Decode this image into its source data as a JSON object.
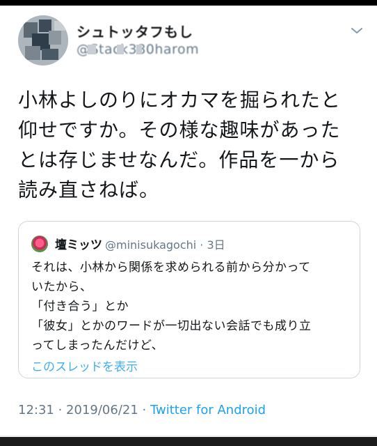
{
  "author": {
    "display_name": "シュトッタフもし",
    "handle": "@Stack380harom"
  },
  "tweet": {
    "lines": [
      "小林よしのりにオカマを掘られたと",
      "仰せですか。その様な趣味があった",
      "とは存じませなんだ。作品を一から",
      "読み直さねば。"
    ]
  },
  "quote": {
    "name": "壇ミッツ",
    "handle": "@minisukagochi",
    "time": "3日",
    "lines": [
      "それは、小林から関係を求められる前から分かって",
      "いたから、",
      "「付き合う」とか",
      "「彼女」とかのワードが一切出ない会話でも成り立",
      "ってしまったんだけど、"
    ],
    "show_thread": "このスレッドを表示"
  },
  "meta": {
    "time": "12:31",
    "date": "2019/06/21",
    "source": "Twitter for Android",
    "separator": " · "
  },
  "colors": {
    "accent": "#1da1f2",
    "secondary_text": "#657786",
    "border": "#ccd6dd"
  },
  "icons": {
    "menu": "chevron-down-icon"
  }
}
